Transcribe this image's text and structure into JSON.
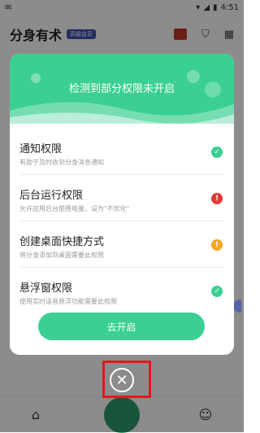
{
  "status_bar": {
    "time": "4:51"
  },
  "app_bar": {
    "title": "分身有术",
    "badge": "高级会员"
  },
  "dialog": {
    "title": "检测到部分权限未开启",
    "permissions": [
      {
        "title": "通知权限",
        "desc": "有助于及时收到分身消息通知",
        "status": "granted",
        "icon": "check-icon"
      },
      {
        "title": "后台运行权限",
        "desc": "允许应用后台使用电量，设为\"不优化\"",
        "status": "missing",
        "icon": "exclamation-icon"
      },
      {
        "title": "创建桌面快捷方式",
        "desc": "将分身添加到桌面需要此权限",
        "status": "warning",
        "icon": "exclamation-icon"
      },
      {
        "title": "悬浮窗权限",
        "desc": "使用实时语音悬浮功能需要此权限",
        "status": "granted",
        "icon": "check-icon"
      }
    ],
    "button_label": "去开启"
  },
  "colors": {
    "accent": "#3bcf93",
    "error": "#e53935",
    "warning": "#f5a623",
    "highlight": "#e0181c"
  }
}
